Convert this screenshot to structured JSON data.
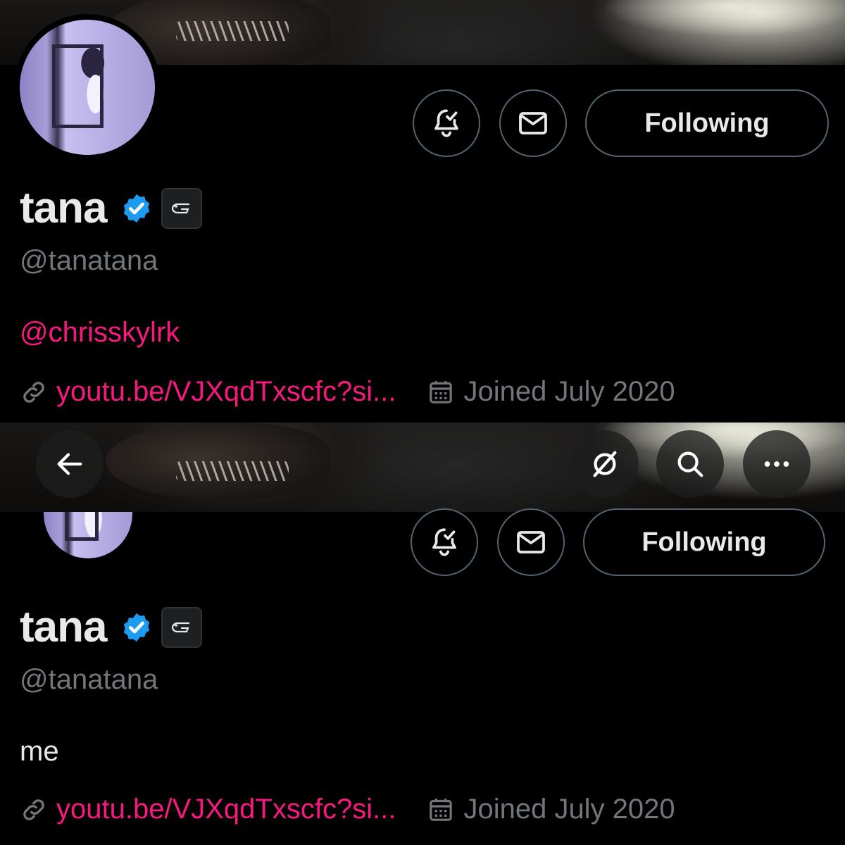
{
  "colors": {
    "accent": "#f91880",
    "verified_blue": "#1d9bf0",
    "secondary_text": "#71767b",
    "border": "#536471"
  },
  "top": {
    "header": {
      "notifications_icon": "bell-check-icon",
      "message_icon": "envelope-icon",
      "follow_label": "Following"
    },
    "profile": {
      "display_name": "tana",
      "verified_icon": "verified-badge-icon",
      "affiliate_icon": "affiliate-badge-icon",
      "handle": "@tanatana",
      "bio": "@chrisskylrk",
      "link_icon": "link-icon",
      "link_text": "youtu.be/VJXqdTxscfc?si...",
      "calendar_icon": "calendar-icon",
      "joined_text": "Joined July 2020"
    }
  },
  "bottom": {
    "nav": {
      "back_icon": "back-arrow-icon",
      "grok_icon": "grok-slash-icon",
      "search_icon": "search-icon",
      "more_icon": "more-dots-icon"
    },
    "header": {
      "notifications_icon": "bell-check-icon",
      "message_icon": "envelope-icon",
      "follow_label": "Following"
    },
    "profile": {
      "display_name": "tana",
      "verified_icon": "verified-badge-icon",
      "affiliate_icon": "affiliate-badge-icon",
      "handle": "@tanatana",
      "bio": "me",
      "link_icon": "link-icon",
      "link_text": "youtu.be/VJXqdTxscfc?si...",
      "calendar_icon": "calendar-icon",
      "joined_text": "Joined July 2020"
    }
  }
}
